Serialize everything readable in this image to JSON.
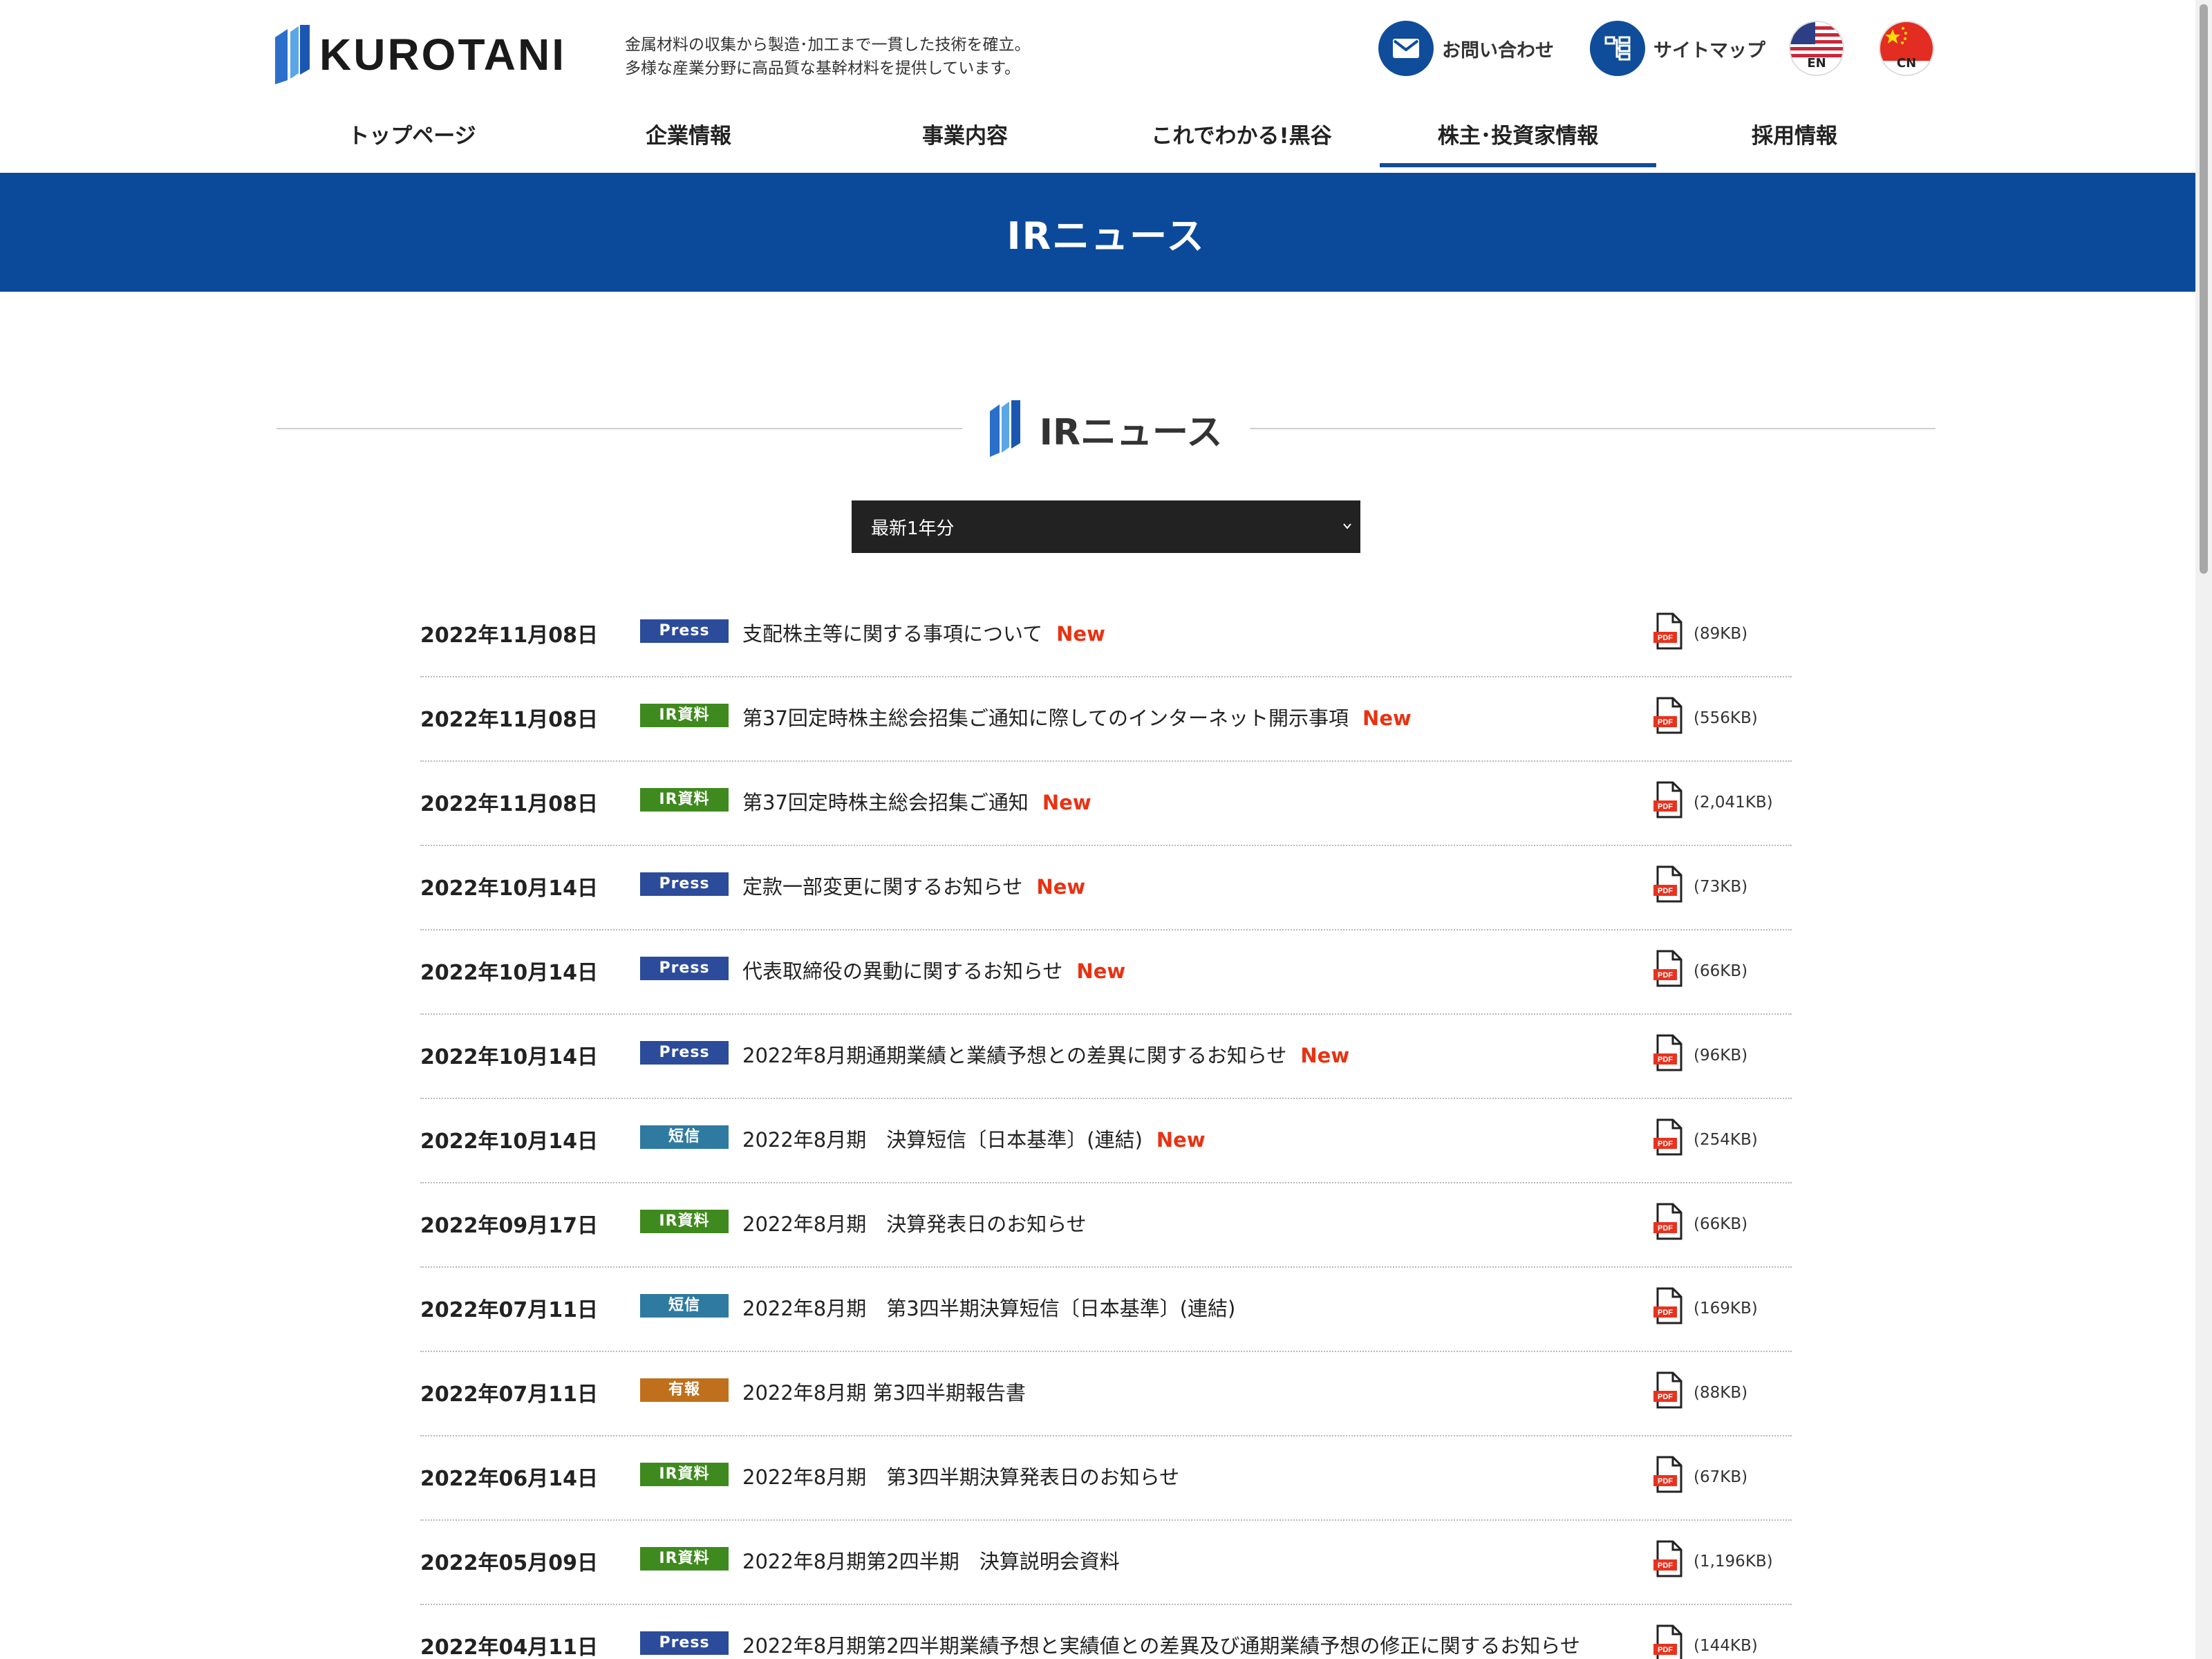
{
  "brand": {
    "name": "KUROTANI",
    "primary_color": "#0b4a9b",
    "accent_color": "#e83212"
  },
  "header": {
    "tagline_line1": "金属材料の収集から製造･加工まで一貫した技術を確立。",
    "tagline_line2": "多様な産業分野に高品質な基幹材料を提供しています。",
    "contact_label": "お問い合わせ",
    "sitemap_label": "サイトマップ",
    "lang_en": "EN",
    "lang_cn": "CN"
  },
  "nav": {
    "items": [
      {
        "label": "トップページ",
        "active": false
      },
      {
        "label": "企業情報",
        "active": false
      },
      {
        "label": "事業内容",
        "active": false
      },
      {
        "label": "これでわかる!黒谷",
        "active": false
      },
      {
        "label": "株主･投資家情報",
        "active": true
      },
      {
        "label": "採用情報",
        "active": false
      }
    ]
  },
  "page": {
    "band_title": "IRニュース",
    "section_title": "IRニュース",
    "filter_value": "最新1年分"
  },
  "badge_colors": {
    "Press": "#2c4b9a",
    "IR資料": "#3f8a1e",
    "短信": "#2f7aa0",
    "有報": "#c0701c"
  },
  "news": [
    {
      "date": "2022年11月08日",
      "badge": "Press",
      "title": "支配株主等に関する事項について",
      "new": "New",
      "size": "(89KB)"
    },
    {
      "date": "2022年11月08日",
      "badge": "IR資料",
      "title": "第37回定時株主総会招集ご通知に際してのインターネット開示事項",
      "new": "New",
      "size": "(556KB)"
    },
    {
      "date": "2022年11月08日",
      "badge": "IR資料",
      "title": "第37回定時株主総会招集ご通知",
      "new": "New",
      "size": "(2,041KB)"
    },
    {
      "date": "2022年10月14日",
      "badge": "Press",
      "title": "定款一部変更に関するお知らせ",
      "new": "New",
      "size": "(73KB)"
    },
    {
      "date": "2022年10月14日",
      "badge": "Press",
      "title": "代表取締役の異動に関するお知らせ",
      "new": "New",
      "size": "(66KB)"
    },
    {
      "date": "2022年10月14日",
      "badge": "Press",
      "title": "2022年8月期通期業績と業績予想との差異に関するお知らせ",
      "new": "New",
      "size": "(96KB)"
    },
    {
      "date": "2022年10月14日",
      "badge": "短信",
      "title": "2022年8月期　決算短信〔日本基準〕(連結)",
      "new": "New",
      "size": "(254KB)"
    },
    {
      "date": "2022年09月17日",
      "badge": "IR資料",
      "title": "2022年8月期　決算発表日のお知らせ",
      "new": "",
      "size": "(66KB)"
    },
    {
      "date": "2022年07月11日",
      "badge": "短信",
      "title": "2022年8月期　第3四半期決算短信〔日本基準〕(連結)",
      "new": "",
      "size": "(169KB)"
    },
    {
      "date": "2022年07月11日",
      "badge": "有報",
      "title": "2022年8月期 第3四半期報告書",
      "new": "",
      "size": "(88KB)"
    },
    {
      "date": "2022年06月14日",
      "badge": "IR資料",
      "title": "2022年8月期　第3四半期決算発表日のお知らせ",
      "new": "",
      "size": "(67KB)"
    },
    {
      "date": "2022年05月09日",
      "badge": "IR資料",
      "title": "2022年8月期第2四半期　決算説明会資料",
      "new": "",
      "size": "(1,196KB)"
    },
    {
      "date": "2022年04月11日",
      "badge": "Press",
      "title": "2022年8月期第2四半期業績予想と実績値との差異及び通期業績予想の修正に関するお知らせ",
      "new": "",
      "size": "(144KB)"
    }
  ]
}
